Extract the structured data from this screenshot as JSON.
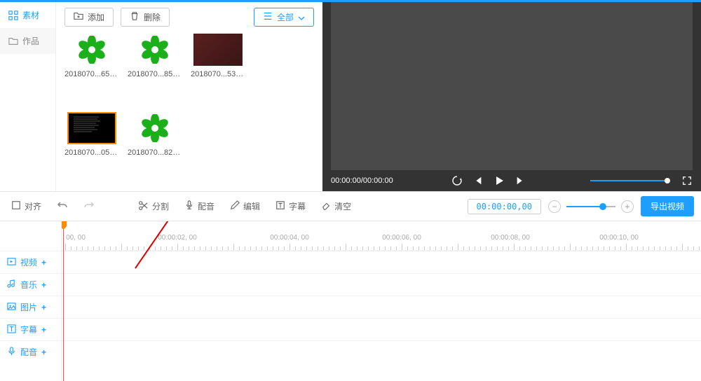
{
  "sidebar": {
    "items": [
      {
        "label": "素材",
        "active": true
      },
      {
        "label": "作品",
        "active": false
      }
    ]
  },
  "asset_toolbar": {
    "add_label": "添加",
    "delete_label": "删除",
    "filter_label": "全部"
  },
  "assets": [
    {
      "name": "2018070...653.mp4",
      "type": "flower"
    },
    {
      "name": "2018070...857.mp4",
      "type": "flower"
    },
    {
      "name": "2018070...536.mp4",
      "type": "photo"
    },
    {
      "name": "2018070...053.mp4",
      "type": "dark",
      "selected": true
    },
    {
      "name": "2018070...826.mp4",
      "type": "flower"
    }
  ],
  "preview": {
    "time_label": "00:00:00/00:00:00"
  },
  "editor_toolbar": {
    "align_label": "对齐",
    "split_label": "分割",
    "dub_label": "配音",
    "edit_label": "编辑",
    "subtitle_label": "字幕",
    "clear_label": "清空",
    "time_display": "00:00:00,00",
    "export_label": "导出视频"
  },
  "tracks": [
    {
      "label": "视频"
    },
    {
      "label": "音乐"
    },
    {
      "label": "图片"
    },
    {
      "label": "字幕"
    },
    {
      "label": "配音"
    }
  ],
  "ruler_ticks": [
    "00, 00",
    "00:00:02, 00",
    "00:00:04, 00",
    "00:00:06, 00",
    "00:00:08, 00",
    "00:00:10, 00"
  ]
}
